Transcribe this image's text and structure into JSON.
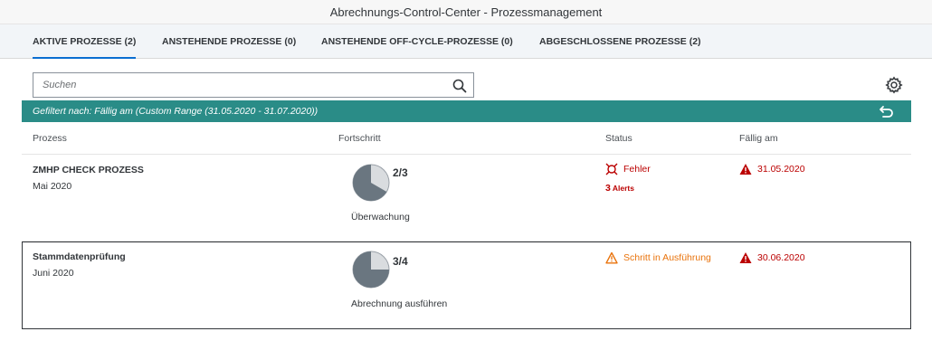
{
  "window": {
    "title": "Abrechnungs-Control-Center - Prozessmanagement"
  },
  "tabs": [
    {
      "label": "AKTIVE PROZESSE (2)",
      "active": true
    },
    {
      "label": "ANSTEHENDE PROZESSE (0)",
      "active": false
    },
    {
      "label": "ANSTEHENDE OFF-CYCLE-PROZESSE (0)",
      "active": false
    },
    {
      "label": "ABGESCHLOSSENE PROZESSE (2)",
      "active": false
    }
  ],
  "search": {
    "placeholder": "Suchen",
    "value": "",
    "icon": "search-icon"
  },
  "toolbar": {
    "settings_icon": "gear-icon"
  },
  "filter": {
    "text": "Gefiltert nach: Fällig am (Custom Range (31.05.2020 - 31.07.2020))",
    "reset_icon": "undo-icon"
  },
  "columns": [
    "Prozess",
    "Fortschritt",
    "Status",
    "Fällig am"
  ],
  "rows": [
    {
      "name": "ZMHP CHECK PROZESS",
      "period": "Mai 2020",
      "progress": {
        "done": 2,
        "total": 3,
        "label": "2/3"
      },
      "step": "Überwachung",
      "status": {
        "text": "Fehler",
        "type": "error",
        "icon": "error-icon"
      },
      "alerts": {
        "count": "3",
        "label": "Alerts"
      },
      "due": {
        "date": "31.05.2020",
        "icon": "warning-icon"
      }
    },
    {
      "name": "Stammdatenprüfung",
      "period": "Juni 2020",
      "progress": {
        "done": 3,
        "total": 4,
        "label": "3/4"
      },
      "step": "Abrechnung ausführen",
      "status": {
        "text": "Schritt in Ausführung",
        "type": "warning",
        "icon": "warning-outline-icon"
      },
      "due": {
        "date": "30.06.2020",
        "icon": "warning-icon"
      }
    }
  ],
  "colors": {
    "accent": "#0a6ed1",
    "filter_bar": "#2a8c87",
    "error": "#bb0000",
    "warning": "#e9730c",
    "pie_fill": "#6a7680",
    "pie_bg": "#d9dcdf"
  }
}
